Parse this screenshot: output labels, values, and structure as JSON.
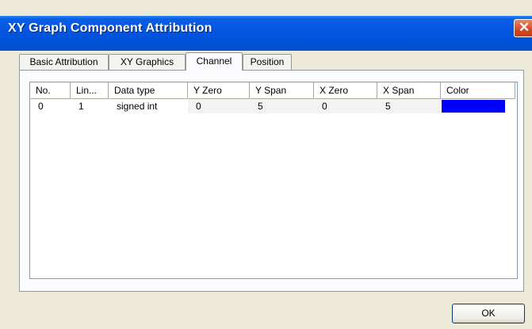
{
  "window": {
    "title": "XY Graph Component Attribution",
    "close_glyph": "✕"
  },
  "tabs": [
    {
      "label": "Basic Attribution",
      "active": false
    },
    {
      "label": "XY Graphics",
      "active": false
    },
    {
      "label": "Channel",
      "active": true
    },
    {
      "label": "Position",
      "active": false
    }
  ],
  "table": {
    "columns": [
      "No.",
      "Lin...",
      "Data type",
      "Y Zero",
      "Y Span",
      "X Zero",
      "X Span",
      "Color"
    ],
    "rows": [
      {
        "no": "0",
        "line": "1",
        "data_type": "signed int",
        "y_zero": "0",
        "y_span": "5",
        "x_zero": "0",
        "x_span": "5",
        "color": "#0000ff"
      }
    ]
  },
  "buttons": {
    "ok_label": "OK"
  }
}
